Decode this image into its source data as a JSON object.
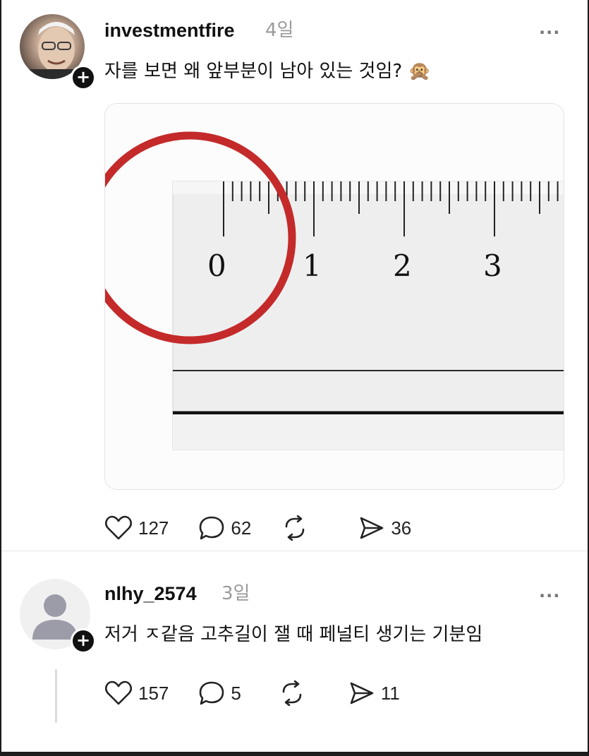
{
  "post1": {
    "username": "investmentfire",
    "time": "4일",
    "more": "···",
    "text": "자를 보면 왜 앞부분이 남아 있는 것임? 🙊",
    "ruler_labels": [
      "0",
      "1",
      "2",
      "3"
    ],
    "highlight_color": "#c42a2a",
    "likes": "127",
    "comments": "62",
    "shares": "36"
  },
  "post2": {
    "username": "nlhy_2574",
    "time": "3일",
    "more": "···",
    "text": "저거 ㅈ같음 고추길이 잴 때 페널티 생기는 기분임",
    "likes": "157",
    "comments": "5",
    "shares": "11"
  },
  "icons": {
    "like": "heart-icon",
    "comment": "comment-bubble-icon",
    "repost": "repost-icon",
    "share": "send-icon",
    "follow": "plus-icon"
  }
}
